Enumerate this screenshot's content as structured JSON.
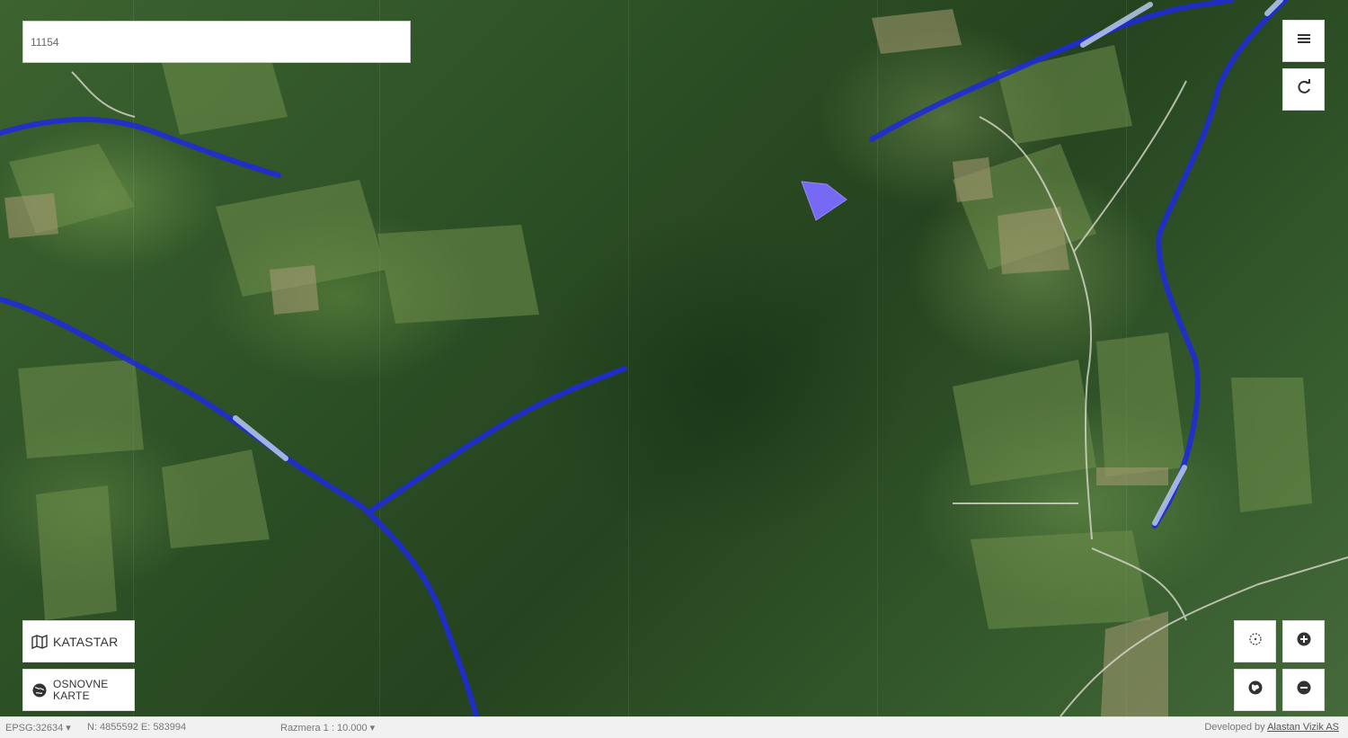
{
  "search": {
    "value": "11154",
    "placeholder": ""
  },
  "buttons": {
    "menu_icon": "hamburger-icon",
    "refresh_icon": "refresh-icon",
    "katastar_label": "KATASTAR",
    "osnovne_karte_label": "OSNOVNE KARTE",
    "locate_icon": "crosshair-icon",
    "zoom_in_icon": "plus-icon",
    "globe_icon": "globe-icon",
    "zoom_out_icon": "minus-icon"
  },
  "status_bar": {
    "projection": "EPSG:32634 ▾",
    "coordinates": "N: 4855592 E: 583994",
    "scale": "Razmera 1 : 10.000 ▾",
    "developed_by_prefix": "Developed by",
    "developer": "Alastan Vizik AS"
  },
  "colors": {
    "river": "#1f2bd6",
    "river_highlight": "#b9c9ee",
    "parcel": "#7b6bff",
    "road": "#d8d8cc"
  }
}
